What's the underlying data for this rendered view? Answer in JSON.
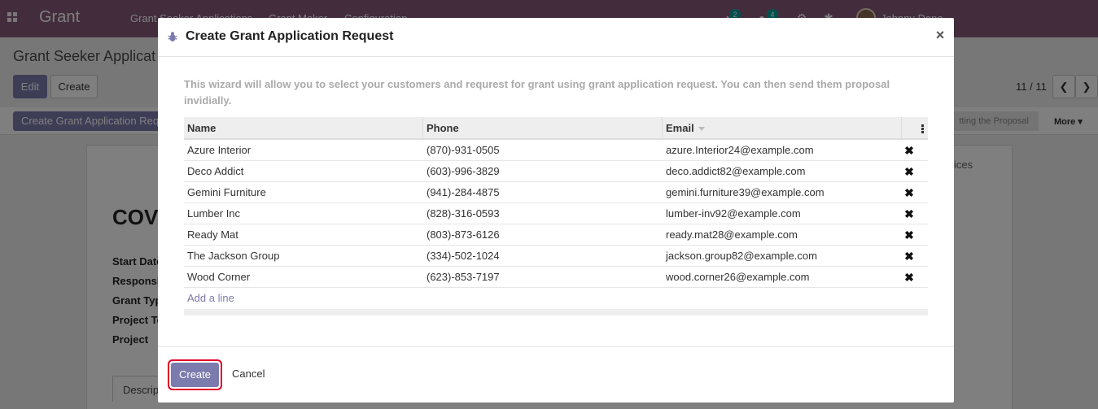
{
  "app": {
    "brand": "Grant",
    "menus": [
      "Grant Seeker Applications",
      "Grant Maker",
      "Configuration"
    ],
    "activity_count": "2",
    "message_count": "4",
    "user": "Johnny Dope"
  },
  "control_panel": {
    "title": "Grant Seeker Applicat",
    "edit_label": "Edit",
    "create_label": "Create",
    "pager": "11 / 11",
    "create_grant_button": "Create Grant Application Request",
    "stage": "tting the Proposal",
    "more": "More ▾"
  },
  "sheet": {
    "heading": "COV",
    "fields": [
      "Start Date",
      "Responsi",
      "Grant Typ",
      "Project Te",
      "Project"
    ],
    "tab_label": "Descrip",
    "tab_right": "ices"
  },
  "modal": {
    "title": "Create Grant Application Request",
    "description": "This wizard will allow you to select your customers and requrest for grant using grant application request. You can then send them proposal invidially.",
    "columns": [
      "Name",
      "Phone",
      "Email"
    ],
    "rows": [
      {
        "name": "Azure Interior",
        "phone": "(870)-931-0505",
        "email": "azure.Interior24@example.com"
      },
      {
        "name": "Deco Addict",
        "phone": "(603)-996-3829",
        "email": "deco.addict82@example.com"
      },
      {
        "name": "Gemini Furniture",
        "phone": "(941)-284-4875",
        "email": "gemini.furniture39@example.com"
      },
      {
        "name": "Lumber Inc",
        "phone": "(828)-316-0593",
        "email": "lumber-inv92@example.com"
      },
      {
        "name": "Ready Mat",
        "phone": "(803)-873-6126",
        "email": "ready.mat28@example.com"
      },
      {
        "name": "The Jackson Group",
        "phone": "(334)-502-1024",
        "email": "jackson.group82@example.com"
      },
      {
        "name": "Wood Corner",
        "phone": "(623)-853-7197",
        "email": "wood.corner26@example.com"
      }
    ],
    "add_line": "Add a line",
    "create_label": "Create",
    "cancel_label": "Cancel"
  },
  "colors": {
    "brand": "#875a7b",
    "primary": "#7c7bad",
    "highlight": "#e0002a"
  }
}
